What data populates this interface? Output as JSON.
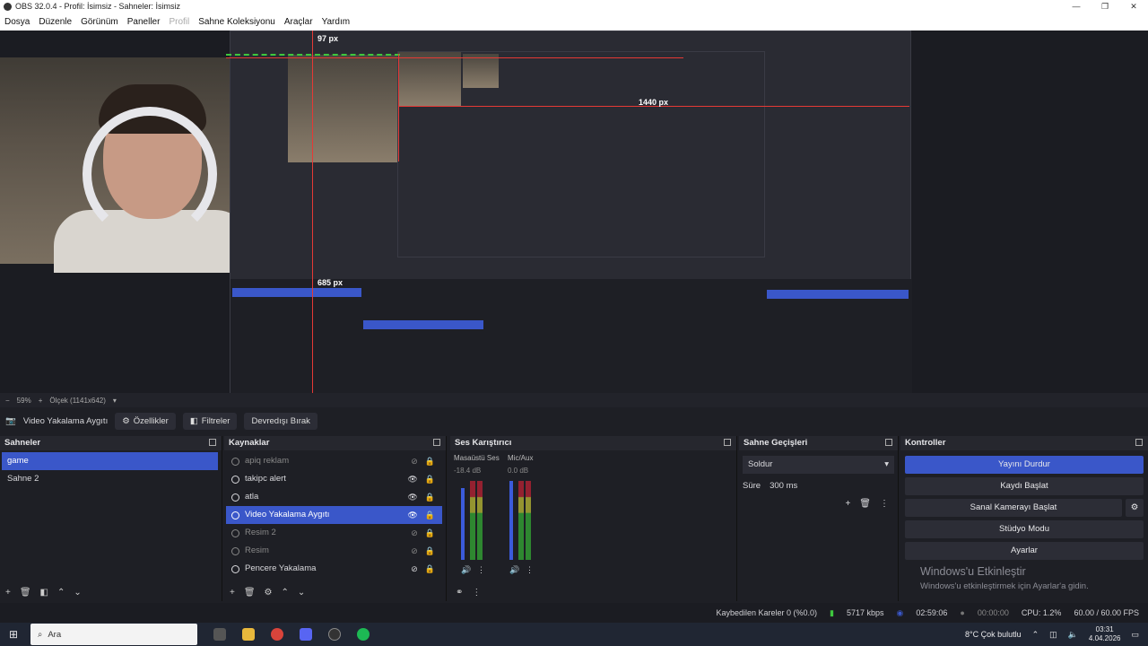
{
  "window": {
    "title": "OBS 32.0.4 - Profil: İsimsiz - Sahneler: İsimsiz",
    "minimize": "—",
    "maximize": "❐",
    "close": "✕"
  },
  "menu": [
    "Dosya",
    "Düzenle",
    "Görünüm",
    "Paneller",
    "Profil",
    "Sahne Koleksiyonu",
    "Araçlar",
    "Yardım"
  ],
  "preview": {
    "labels": {
      "top": "97 px",
      "right": "1440 px",
      "left": "685 px"
    },
    "zoom": "59%",
    "scale": "Ölçek (1141x642)"
  },
  "source_toolbar": {
    "source_name": "Video Yakalama Aygıtı",
    "properties": "Özellikler",
    "filters": "Filtreler",
    "deactivate": "Devredışı Bırak"
  },
  "scenes": {
    "title": "Sahneler",
    "items": [
      "game",
      "Sahne 2"
    ],
    "selected": 0
  },
  "sources": {
    "title": "Kaynaklar",
    "items": [
      {
        "name": "apiq reklam",
        "state": "dimmed"
      },
      {
        "name": "takipc alert",
        "state": "normal"
      },
      {
        "name": "atla",
        "state": "normal"
      },
      {
        "name": "Video Yakalama Aygıtı",
        "state": "selected"
      },
      {
        "name": "Resim 2",
        "state": "dimmed"
      },
      {
        "name": "Resim",
        "state": "dimmed"
      },
      {
        "name": "Pencere Yakalama",
        "state": "normal"
      }
    ]
  },
  "mixer": {
    "title": "Ses Karıştırıcı",
    "channels": [
      {
        "name": "Masaüstü Ses",
        "db": "-18.4 dB"
      },
      {
        "name": "Mic/Aux",
        "db": "0.0 dB"
      }
    ],
    "scale": [
      "0",
      "-5",
      "-10",
      "-15",
      "-20",
      "-25",
      "-30",
      "-35",
      "-40",
      "-45",
      "-50",
      "-55",
      "-60"
    ]
  },
  "transitions": {
    "title": "Sahne Geçişleri",
    "selected": "Soldur",
    "duration_label": "Süre",
    "duration": "300 ms"
  },
  "controls": {
    "title": "Kontroller",
    "buttons": [
      "Yayını Durdur",
      "Kaydı Başlat",
      "Sanal Kamerayı Başlat",
      "Stüdyo Modu",
      "Ayarlar"
    ]
  },
  "watermark": {
    "title": "Windows'u Etkinleştir",
    "subtitle": "Windows'u etkinleştirmek için Ayarlar'a gidin."
  },
  "status": {
    "dropped": "Kaybedilen Kareler 0 (%0.0)",
    "bitrate": "5717 kbps",
    "stream_time": "02:59:06",
    "rec_time": "00:00:00",
    "cpu": "CPU: 1.2%",
    "fps": "60.00 / 60.00 FPS"
  },
  "taskbar": {
    "search": "Ara",
    "weather": "8°C  Çok bulutlu",
    "time": "03:31",
    "date": "4.04.2026"
  },
  "colors": {
    "accent": "#3a57c9",
    "guide": "#e53935",
    "bounding": "#3ec73e"
  }
}
